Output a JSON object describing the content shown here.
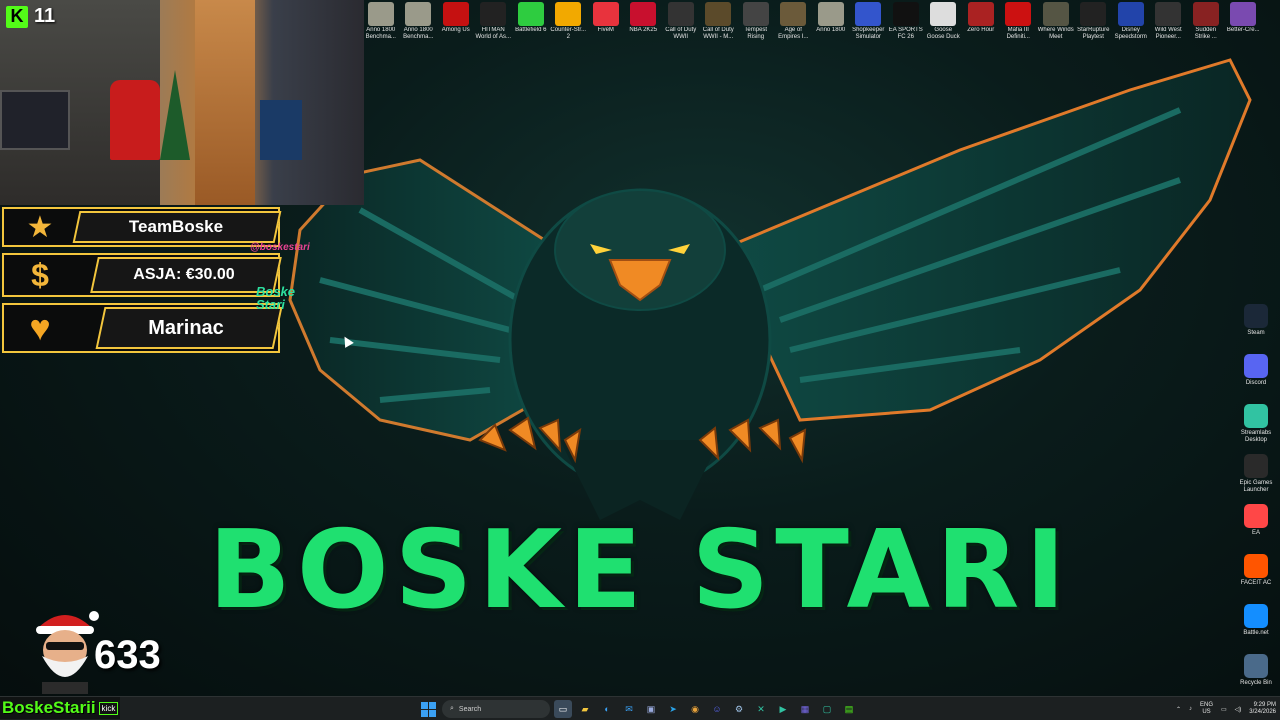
{
  "brand": {
    "title": "BOSKE STARI"
  },
  "webcam": {
    "kick_viewers": "11"
  },
  "overlay": {
    "follower_label": "TeamBoske",
    "donation_label": "ASJA: €30.00",
    "subscriber_label": "Marinac",
    "instagram_handle": "@boskestari",
    "tiktok_name": "Boske Stari"
  },
  "follower_count": "633",
  "channel": {
    "name": "BoskeStarii",
    "platform": "kick"
  },
  "top_icons": [
    {
      "label": "Anno 1800 Benchma...",
      "color": "#9a9a8a",
      "icon": "anno-icon"
    },
    {
      "label": "Anno 1800 Benchma...",
      "color": "#9a9a8a",
      "icon": "anno-icon"
    },
    {
      "label": "Among Us",
      "color": "#c51111",
      "icon": "among-us-icon"
    },
    {
      "label": "HITMAN World of As...",
      "color": "#222222",
      "icon": "hitman-icon"
    },
    {
      "label": "Battlefield 6",
      "color": "#2ecc40",
      "icon": "battlefield-icon"
    },
    {
      "label": "Counter-Str... 2",
      "color": "#f2a900",
      "icon": "counter-strike-icon"
    },
    {
      "label": "FiveM",
      "color": "#e8333d",
      "icon": "fivem-icon"
    },
    {
      "label": "NBA 2K25",
      "color": "#c8102e",
      "icon": "nba-icon"
    },
    {
      "label": "Call of Duty WWII",
      "color": "#333333",
      "icon": "call-of-duty-icon"
    },
    {
      "label": "Call of Duty WWII - M...",
      "color": "#5b4a2a",
      "icon": "call-of-duty-icon"
    },
    {
      "label": "Tempest Rising",
      "color": "#444444",
      "icon": "tempest-icon"
    },
    {
      "label": "Age of Empires I...",
      "color": "#6b5a3a",
      "icon": "age-of-empires-icon"
    },
    {
      "label": "Anno 1800",
      "color": "#9a9a8a",
      "icon": "anno-icon"
    },
    {
      "label": "Shopkeeper Simulator",
      "color": "#3355cc",
      "icon": "shopkeeper-icon"
    },
    {
      "label": "EA SPORTS FC 26",
      "color": "#111111",
      "icon": "ea-fc-icon"
    },
    {
      "label": "Goose Goose Duck",
      "color": "#dddddd",
      "icon": "goose-icon"
    },
    {
      "label": "Zero Hour",
      "color": "#aa2222",
      "icon": "zero-hour-icon"
    },
    {
      "label": "Mafia III Definiti...",
      "color": "#cc1111",
      "icon": "mafia-icon"
    },
    {
      "label": "Where Winds Meet",
      "color": "#555544",
      "icon": "where-winds-meet-icon"
    },
    {
      "label": "StarRupture Playtest",
      "color": "#222222",
      "icon": "starrupture-icon"
    },
    {
      "label": "Disney Speedstorm",
      "color": "#2244aa",
      "icon": "speedstorm-icon"
    },
    {
      "label": "Wild West Pioneer...",
      "color": "#333333",
      "icon": "wheel-icon"
    },
    {
      "label": "Sudden Strike ...",
      "color": "#882222",
      "icon": "sudden-strike-icon"
    },
    {
      "label": "Better-Cre...",
      "color": "#7a4ab0",
      "icon": "better-icon"
    }
  ],
  "right_icons": [
    {
      "label": "Steam",
      "color": "#1b2838",
      "icon": "steam-icon"
    },
    {
      "label": "Discord",
      "color": "#5865f2",
      "icon": "discord-icon"
    },
    {
      "label": "Streamlabs Desktop",
      "color": "#31c3a2",
      "icon": "streamlabs-icon"
    },
    {
      "label": "Epic Games Launcher",
      "color": "#2a2a2a",
      "icon": "epic-games-icon"
    },
    {
      "label": "EA",
      "color": "#ff4747",
      "icon": "ea-icon"
    },
    {
      "label": "FACEIT AC",
      "color": "#ff5500",
      "icon": "faceit-icon"
    },
    {
      "label": "Battle.net",
      "color": "#148eff",
      "icon": "battlenet-icon"
    },
    {
      "label": "Recycle Bin",
      "color": "#4a6a8a",
      "icon": "recycle-bin-icon"
    }
  ],
  "taskbar": {
    "search_placeholder": "Search",
    "lang_top": "ENG",
    "lang_bottom": "US",
    "time": "9:29 PM",
    "date": "3/24/2026"
  }
}
